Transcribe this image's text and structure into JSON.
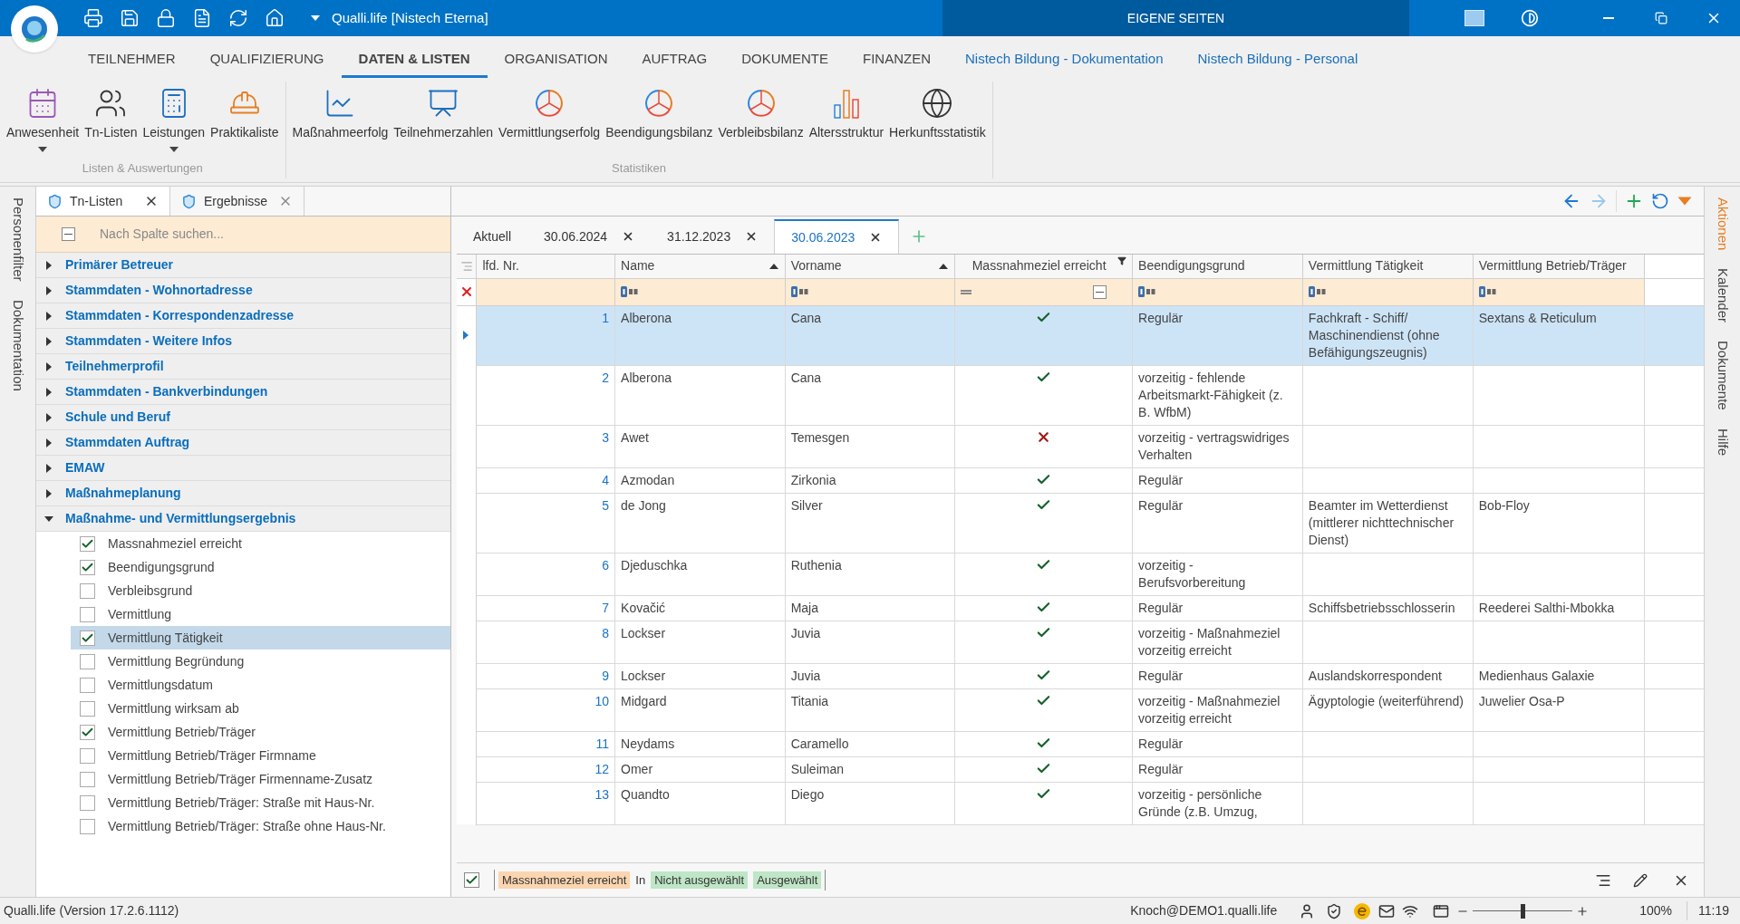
{
  "title_bar": {
    "title": "Qualli.life [Nistech Eterna]",
    "center_tab": "EIGENE SEITEN"
  },
  "menu_tabs": [
    {
      "label": "TEILNEHMER",
      "selected": false,
      "kind": "main"
    },
    {
      "label": "QUALIFIZIERUNG",
      "selected": false,
      "kind": "main"
    },
    {
      "label": "DATEN & LISTEN",
      "selected": true,
      "kind": "main"
    },
    {
      "label": "ORGANISATION",
      "selected": false,
      "kind": "main"
    },
    {
      "label": "AUFTRAG",
      "selected": false,
      "kind": "main"
    },
    {
      "label": "DOKUMENTE",
      "selected": false,
      "kind": "main"
    },
    {
      "label": "FINANZEN",
      "selected": false,
      "kind": "main"
    },
    {
      "label": "Nistech Bildung - Dokumentation",
      "selected": false,
      "kind": "context"
    },
    {
      "label": "Nistech Bildung - Personal",
      "selected": false,
      "kind": "context"
    }
  ],
  "ribbon_groups": [
    {
      "label": "Listen & Auswertungen",
      "buttons": [
        {
          "label": "Anwesenheit",
          "dropdown": true
        },
        {
          "label": "Tn-Listen",
          "dropdown": false
        },
        {
          "label": "Leistungen",
          "dropdown": true
        },
        {
          "label": "Praktikaliste",
          "dropdown": false
        }
      ]
    },
    {
      "label": "Statistiken",
      "buttons": [
        {
          "label": "Maßnahmeerfolg",
          "dropdown": false
        },
        {
          "label": "Teilnehmerzahlen",
          "dropdown": false
        },
        {
          "label": "Vermittlungserfolg",
          "dropdown": false
        },
        {
          "label": "Beendigungsbilanz",
          "dropdown": false
        },
        {
          "label": "Verbleibsbilanz",
          "dropdown": false
        },
        {
          "label": "Altersstruktur",
          "dropdown": false
        },
        {
          "label": "Herkunftsstatistik",
          "dropdown": false
        }
      ]
    }
  ],
  "left_strip": [
    "Personenfilter",
    "Dokumentation"
  ],
  "right_strip": [
    {
      "label": "Aktionen",
      "selected": true
    },
    {
      "label": "Kalender",
      "selected": false
    },
    {
      "label": "Dokumente",
      "selected": false
    },
    {
      "label": "Hilfe",
      "selected": false
    }
  ],
  "panel_tabs": [
    {
      "label": "Tn-Listen",
      "selected": true
    },
    {
      "label": "Ergebnisse",
      "selected": false
    }
  ],
  "column_search": {
    "placeholder": "Nach Spalte suchen..."
  },
  "field_groups": [
    {
      "label": "Primärer Betreuer",
      "expanded": false
    },
    {
      "label": "Stammdaten - Wohnortadresse",
      "expanded": false
    },
    {
      "label": "Stammdaten - Korrespondenzadresse",
      "expanded": false
    },
    {
      "label": "Stammdaten - Weitere Infos",
      "expanded": false
    },
    {
      "label": "Teilnehmerprofil",
      "expanded": false
    },
    {
      "label": "Stammdaten - Bankverbindungen",
      "expanded": false
    },
    {
      "label": "Schule und Beruf",
      "expanded": false
    },
    {
      "label": "Stammdaten Auftrag",
      "expanded": false
    },
    {
      "label": "EMAW",
      "expanded": false
    },
    {
      "label": "Maßnahmeplanung",
      "expanded": false
    },
    {
      "label": "Maßnahme- und Vermittlungsergebnis",
      "expanded": true,
      "children": [
        {
          "label": "Massnahmeziel erreicht",
          "checked": true,
          "selected": false
        },
        {
          "label": "Beendigungsgrund",
          "checked": true,
          "selected": false
        },
        {
          "label": "Verbleibsgrund",
          "checked": false,
          "selected": false
        },
        {
          "label": "Vermittlung",
          "checked": false,
          "selected": false
        },
        {
          "label": "Vermittlung Tätigkeit",
          "checked": true,
          "selected": true
        },
        {
          "label": "Vermittlung Begründung",
          "checked": false,
          "selected": false
        },
        {
          "label": "Vermittlungsdatum",
          "checked": false,
          "selected": false
        },
        {
          "label": "Vermittlung wirksam ab",
          "checked": false,
          "selected": false
        },
        {
          "label": "Vermittlung Betrieb/Träger",
          "checked": true,
          "selected": false
        },
        {
          "label": "Vermittlung Betrieb/Träger Firmname",
          "checked": false,
          "selected": false
        },
        {
          "label": "Vermittlung Betrieb/Träger Firmenname-Zusatz",
          "checked": false,
          "selected": false
        },
        {
          "label": "Vermittlung Betrieb/Träger: Straße mit Haus-Nr.",
          "checked": false,
          "selected": false
        },
        {
          "label": "Vermittlung Betrieb/Träger: Straße ohne Haus-Nr.",
          "checked": false,
          "selected": false
        }
      ]
    }
  ],
  "date_tabs": [
    {
      "label": "Aktuell",
      "selected": false,
      "closable": false
    },
    {
      "label": "30.06.2024",
      "selected": false,
      "closable": true
    },
    {
      "label": "31.12.2023",
      "selected": false,
      "closable": true
    },
    {
      "label": "30.06.2023",
      "selected": true,
      "closable": true
    }
  ],
  "table": {
    "columns": [
      {
        "label": "lfd. Nr.",
        "kind": "number",
        "sorted": false,
        "filtered": false
      },
      {
        "label": "Name",
        "kind": "text",
        "sorted": true,
        "filtered": false
      },
      {
        "label": "Vorname",
        "kind": "text",
        "sorted": true,
        "filtered": false
      },
      {
        "label": "Massnahmeziel erreicht",
        "kind": "bool",
        "sorted": false,
        "filtered": true,
        "filter_indeterminate": true
      },
      {
        "label": "Beendigungsgrund",
        "kind": "text",
        "sorted": false,
        "filtered": false
      },
      {
        "label": "Vermittlung Tätigkeit",
        "kind": "text",
        "sorted": false,
        "filtered": false
      },
      {
        "label": "Vermittlung Betrieb/Träger",
        "kind": "text",
        "sorted": false,
        "filtered": false
      }
    ],
    "rows": [
      {
        "selected": true,
        "cells": [
          "1",
          "Alberona",
          "Cana",
          true,
          "Regulär",
          "Fachkraft - Schiff/ Maschinendienst (ohne Befähigungszeugnis)",
          "Sextans & Reticulum"
        ]
      },
      {
        "selected": false,
        "cells": [
          "2",
          "Alberona",
          "Cana",
          true,
          "vorzeitig - fehlende Arbeitsmarkt-Fähigkeit (z. B. WfbM)",
          "",
          ""
        ]
      },
      {
        "selected": false,
        "cells": [
          "3",
          "Awet",
          "Temesgen",
          false,
          "vorzeitig - vertragswidriges Verhalten",
          "",
          ""
        ]
      },
      {
        "selected": false,
        "cells": [
          "4",
          "Azmodan",
          "Zirkonia",
          true,
          "Regulär",
          "",
          ""
        ]
      },
      {
        "selected": false,
        "cells": [
          "5",
          "de Jong",
          "Silver",
          true,
          "Regulär",
          "Beamter im Wetterdienst (mittlerer nichttechnischer Dienst)",
          "Bob-Floy"
        ]
      },
      {
        "selected": false,
        "cells": [
          "6",
          "Djeduschka",
          "Ruthenia",
          true,
          "vorzeitig - Berufsvorbereitung",
          "",
          ""
        ]
      },
      {
        "selected": false,
        "cells": [
          "7",
          "Kovačić",
          "Maja",
          true,
          "Regulär",
          "Schiffsbetriebsschlosserin",
          "Reederei Salthi-Mbokka"
        ]
      },
      {
        "selected": false,
        "cells": [
          "8",
          "Lockser",
          "Juvia",
          true,
          "vorzeitig - Maßnahmeziel vorzeitig erreicht",
          "",
          ""
        ]
      },
      {
        "selected": false,
        "cells": [
          "9",
          "Lockser",
          "Juvia",
          true,
          "Regulär",
          "Auslandskorrespondent",
          "Medienhaus Galaxie"
        ]
      },
      {
        "selected": false,
        "cells": [
          "10",
          "Midgard",
          "Titania",
          true,
          "vorzeitig - Maßnahmeziel vorzeitig erreicht",
          "Ägyptologie (weiterführend)",
          "Juwelier Osa-P"
        ]
      },
      {
        "selected": false,
        "cells": [
          "11",
          "Neydams",
          "Caramello",
          true,
          "Regulär",
          "",
          ""
        ]
      },
      {
        "selected": false,
        "cells": [
          "12",
          "Omer",
          "Suleiman",
          true,
          "Regulär",
          "",
          ""
        ]
      },
      {
        "selected": false,
        "cells": [
          "13",
          "Quandto",
          "Diego",
          true,
          "vorzeitig - persönliche Gründe (z.B. Umzug,",
          "",
          ""
        ]
      }
    ]
  },
  "filter_bar": {
    "enabled": true,
    "field": "Massnahmeziel erreicht",
    "operator": "In",
    "values": [
      "Nicht ausgewählt",
      "Ausgewählt"
    ]
  },
  "status_bar": {
    "version": "Qualli.life (Version 17.2.6.1112)",
    "user": "Knoch@DEMO1.qualli.life",
    "zoom": {
      "level": 0.5
    },
    "zoom_text": "100%",
    "time": "11:19"
  }
}
